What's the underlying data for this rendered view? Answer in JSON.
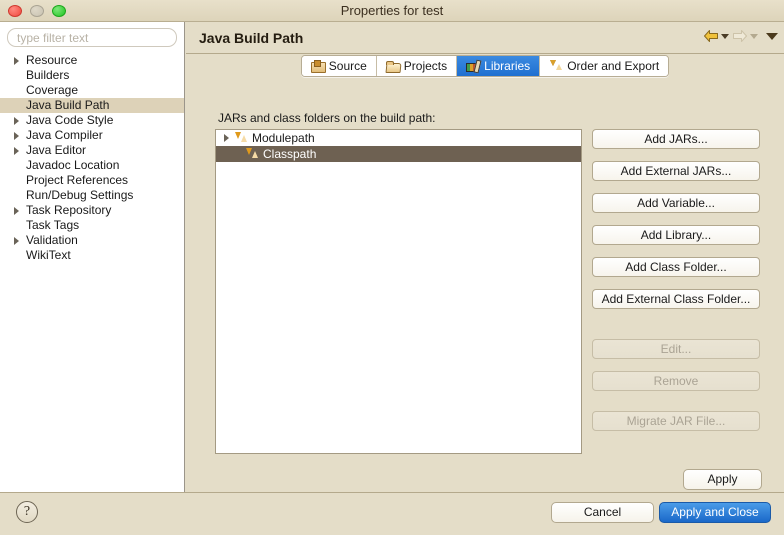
{
  "window": {
    "title": "Properties for test",
    "controls": [
      {
        "name": "close",
        "icon": "close-traffic-light"
      },
      {
        "name": "minimize",
        "icon": "minimize-traffic-light"
      },
      {
        "name": "maximize",
        "icon": "maximize-traffic-light"
      }
    ]
  },
  "sidebar": {
    "filter": {
      "placeholder": "type filter text",
      "value": ""
    },
    "items": [
      {
        "label": "Resource",
        "expandable": true,
        "selected": false
      },
      {
        "label": "Builders",
        "expandable": false,
        "selected": false
      },
      {
        "label": "Coverage",
        "expandable": false,
        "selected": false
      },
      {
        "label": "Java Build Path",
        "expandable": false,
        "selected": true
      },
      {
        "label": "Java Code Style",
        "expandable": true,
        "selected": false
      },
      {
        "label": "Java Compiler",
        "expandable": true,
        "selected": false
      },
      {
        "label": "Java Editor",
        "expandable": true,
        "selected": false
      },
      {
        "label": "Javadoc Location",
        "expandable": false,
        "selected": false
      },
      {
        "label": "Project References",
        "expandable": false,
        "selected": false
      },
      {
        "label": "Run/Debug Settings",
        "expandable": false,
        "selected": false
      },
      {
        "label": "Task Repository",
        "expandable": true,
        "selected": false
      },
      {
        "label": "Task Tags",
        "expandable": false,
        "selected": false
      },
      {
        "label": "Validation",
        "expandable": true,
        "selected": false
      },
      {
        "label": "WikiText",
        "expandable": false,
        "selected": false
      }
    ]
  },
  "pane": {
    "title": "Java Build Path",
    "nav": {
      "back_icon": "back-arrow-icon",
      "back_dropdown_icon": "chevron-down-icon",
      "forward_icon": "forward-arrow-icon",
      "forward_dropdown_icon": "chevron-down-icon",
      "menu_icon": "chevron-down-icon"
    },
    "tabs": [
      {
        "label": "Source",
        "icon": "package-icon",
        "active": false
      },
      {
        "label": "Projects",
        "icon": "folder-icon",
        "active": false
      },
      {
        "label": "Libraries",
        "icon": "books-icon",
        "active": true
      },
      {
        "label": "Order and Export",
        "icon": "up-down-arrows-icon",
        "active": false
      }
    ],
    "content_label": "JARs and class folders on the build path:",
    "list": [
      {
        "label": "Modulepath",
        "icon": "up-down-arrows-icon",
        "expandable": true,
        "selected": false,
        "indent": 0
      },
      {
        "label": "Classpath",
        "icon": "up-down-arrows-icon",
        "expandable": false,
        "selected": true,
        "indent": 1
      }
    ],
    "buttons": [
      {
        "label": "Add JARs...",
        "enabled": true
      },
      {
        "label": "Add External JARs...",
        "enabled": true
      },
      {
        "label": "Add Variable...",
        "enabled": true
      },
      {
        "label": "Add Library...",
        "enabled": true
      },
      {
        "label": "Add Class Folder...",
        "enabled": true
      },
      {
        "label": "Add External Class Folder...",
        "enabled": true
      },
      {
        "label": "Edit...",
        "enabled": false
      },
      {
        "label": "Remove",
        "enabled": false
      },
      {
        "label": "Migrate JAR File...",
        "enabled": false
      }
    ],
    "apply_label": "Apply"
  },
  "footer": {
    "help_label": "?",
    "cancel_label": "Cancel",
    "primary_label": "Apply and Close"
  },
  "colors": {
    "window_bg": "#e4ddc8",
    "accent_blue": "#2a7bd6",
    "selection_brown": "#6e6152",
    "sidebar_selection": "#ddd2b8",
    "icon_gold": "#e09a1c"
  }
}
